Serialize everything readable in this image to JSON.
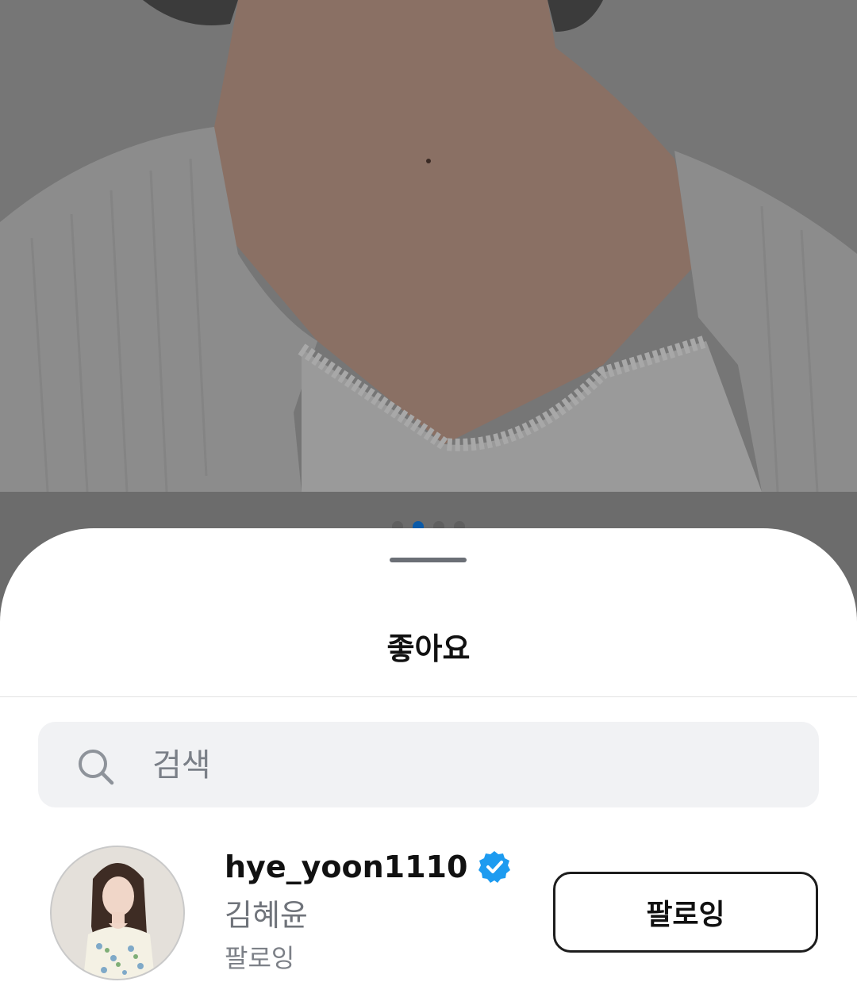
{
  "sheet": {
    "title": "좋아요"
  },
  "carousel": {
    "dot_count": 4,
    "active_index": 1,
    "active_color": "#0a5aa8"
  },
  "search": {
    "placeholder": "검색",
    "value": "",
    "icon": "search-icon"
  },
  "likes": [
    {
      "username": "hye_yoon1110",
      "verified": true,
      "full_name": "김혜윤",
      "relationship": "팔로잉",
      "button_label": "팔로잉"
    }
  ],
  "colors": {
    "verified_blue": "#1d9bf0",
    "sheet_bg": "#ffffff",
    "search_bg": "#f1f2f4"
  }
}
